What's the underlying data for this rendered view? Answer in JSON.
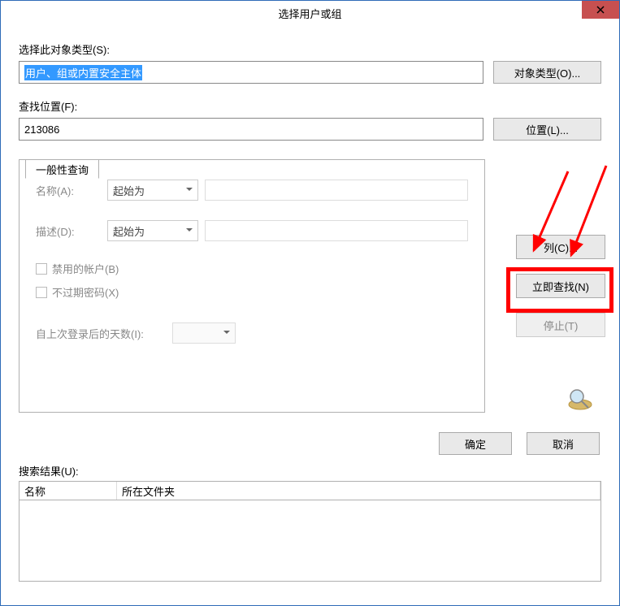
{
  "title": "选择用户或组",
  "section_object_type": {
    "label": "选择此对象类型(S):",
    "value": "用户、组或内置安全主体",
    "button": "对象类型(O)..."
  },
  "section_location": {
    "label": "查找位置(F):",
    "value": "213086",
    "button": "位置(L)..."
  },
  "tab": {
    "label": "一般性查询",
    "name": {
      "label": "名称(A):",
      "combo": "起始为",
      "input": ""
    },
    "desc": {
      "label": "描述(D):",
      "combo": "起始为",
      "input": ""
    },
    "chk_disabled_accounts": "禁用的帐户(B)",
    "chk_non_expiring": "不过期密码(X)",
    "days_since_login": {
      "label": "自上次登录后的天数(I):",
      "combo": ""
    }
  },
  "right_buttons": {
    "columns": "列(C)...",
    "find_now": "立即查找(N)",
    "stop": "停止(T)"
  },
  "bottom_buttons": {
    "ok": "确定",
    "cancel": "取消"
  },
  "results": {
    "label": "搜索结果(U):",
    "columns": {
      "name": "名称",
      "folder": "所在文件夹"
    }
  }
}
